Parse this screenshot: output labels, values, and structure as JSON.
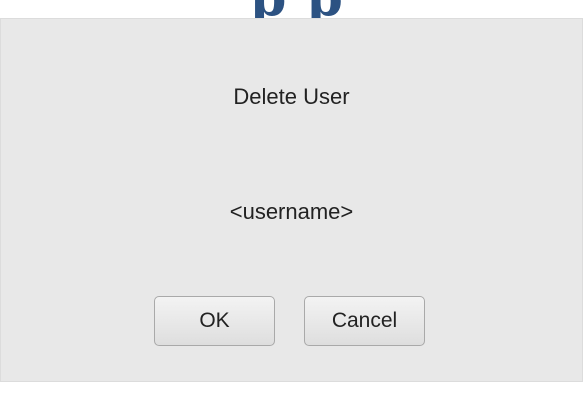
{
  "header": {
    "fragment_text": "p p"
  },
  "dialog": {
    "title": "Delete User",
    "username": "<username>",
    "ok_label": "OK",
    "cancel_label": "Cancel"
  }
}
